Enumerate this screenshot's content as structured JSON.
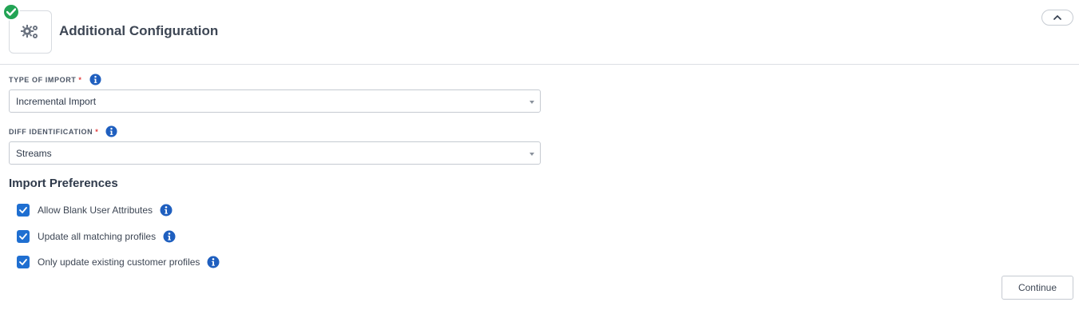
{
  "header": {
    "title": "Additional Configuration",
    "icon": "gears-icon",
    "status_icon": "check-icon",
    "collapse_icon": "chevron-up-icon"
  },
  "form": {
    "type_of_import": {
      "label": "TYPE OF IMPORT",
      "required_mark": "*",
      "value": "Incremental Import"
    },
    "diff_identification": {
      "label": "DIFF IDENTIFICATION",
      "required_mark": "*",
      "value": "Streams"
    }
  },
  "preferences": {
    "title": "Import Preferences",
    "items": [
      {
        "label": "Allow Blank User Attributes",
        "checked": true
      },
      {
        "label": "Update all matching profiles",
        "checked": true
      },
      {
        "label": "Only update existing customer profiles",
        "checked": true
      }
    ]
  },
  "actions": {
    "continue_label": "Continue"
  },
  "colors": {
    "accent": "#1f6fd1",
    "success": "#23a455",
    "required": "#e23b3b"
  }
}
